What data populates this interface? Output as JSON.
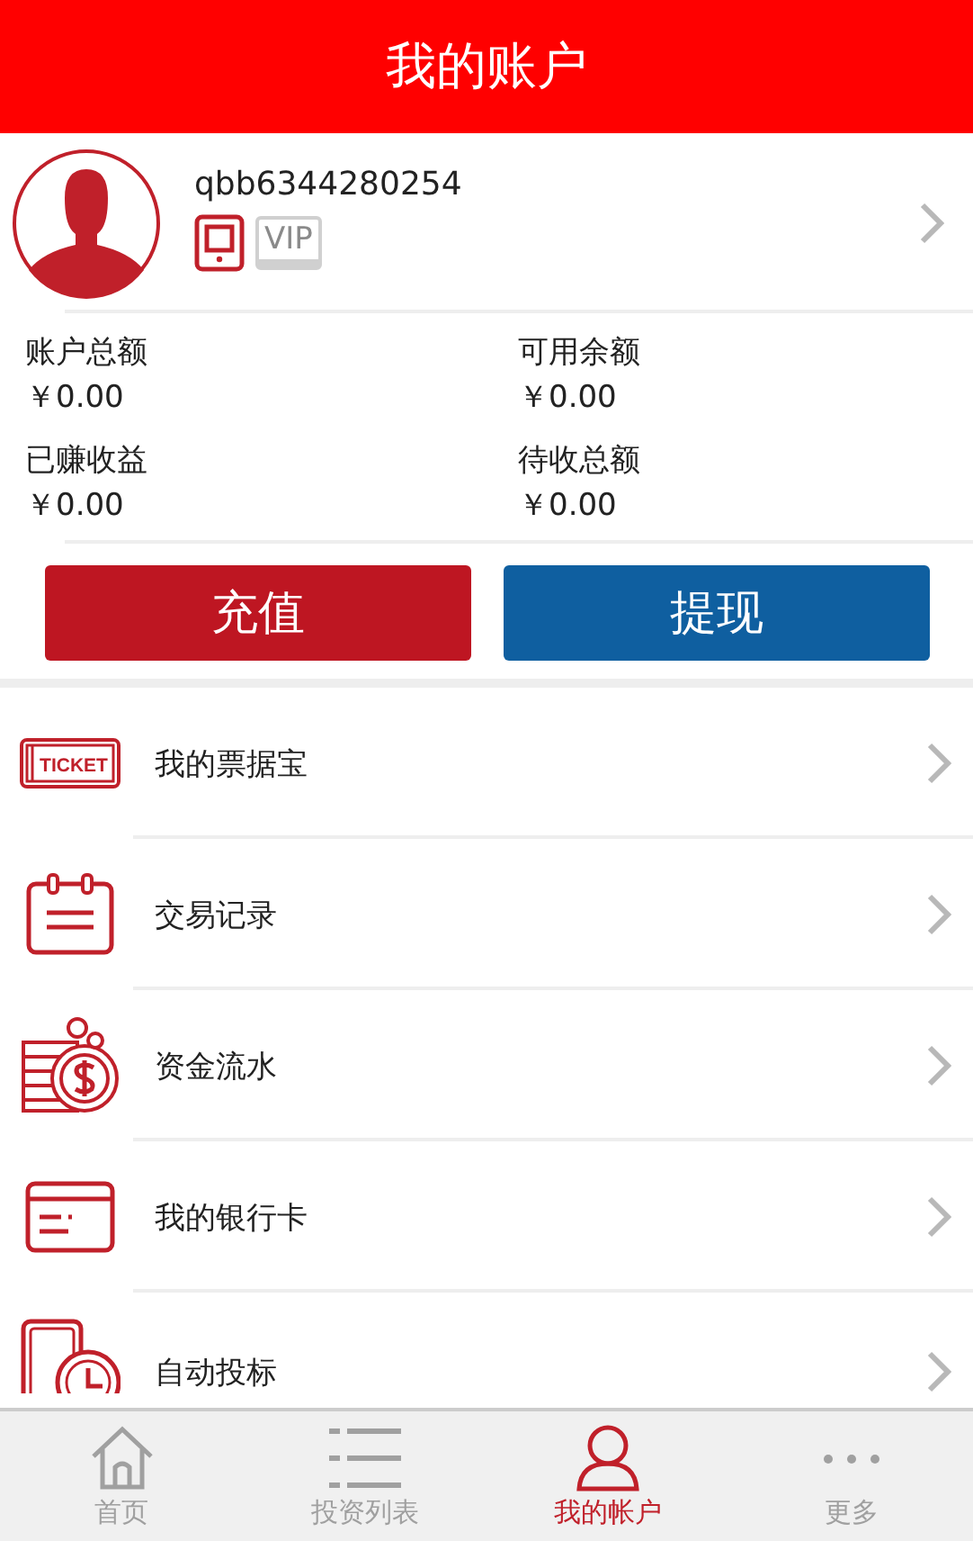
{
  "header": {
    "title": "我的账户"
  },
  "profile": {
    "username": "qbb6344280254",
    "badges": [
      {
        "kind": "phone",
        "active": true
      },
      {
        "kind": "vip",
        "label": "VIP",
        "active": false
      }
    ]
  },
  "stats": [
    {
      "label": "账户总额",
      "value": "￥0.00"
    },
    {
      "label": "可用余额",
      "value": "￥0.00"
    },
    {
      "label": "已赚收益",
      "value": "￥0.00"
    },
    {
      "label": "待收总额",
      "value": "￥0.00"
    }
  ],
  "actions": [
    {
      "kind": "recharge",
      "label": "充值"
    },
    {
      "kind": "withdraw",
      "label": "提现"
    }
  ],
  "menu": [
    {
      "kind": "ticket",
      "label": "我的票据宝",
      "icon_text": "TICKET"
    },
    {
      "kind": "calendar",
      "label": "交易记录"
    },
    {
      "kind": "coins",
      "label": "资金流水"
    },
    {
      "kind": "card",
      "label": "我的银行卡"
    },
    {
      "kind": "auto",
      "label": "自动投标"
    }
  ],
  "nav": [
    {
      "kind": "home",
      "label": "首页",
      "selected": false
    },
    {
      "kind": "list",
      "label": "投资列表",
      "selected": false
    },
    {
      "kind": "user",
      "label": "我的帐户",
      "selected": true
    },
    {
      "kind": "more",
      "label": "更多",
      "selected": false
    }
  ]
}
